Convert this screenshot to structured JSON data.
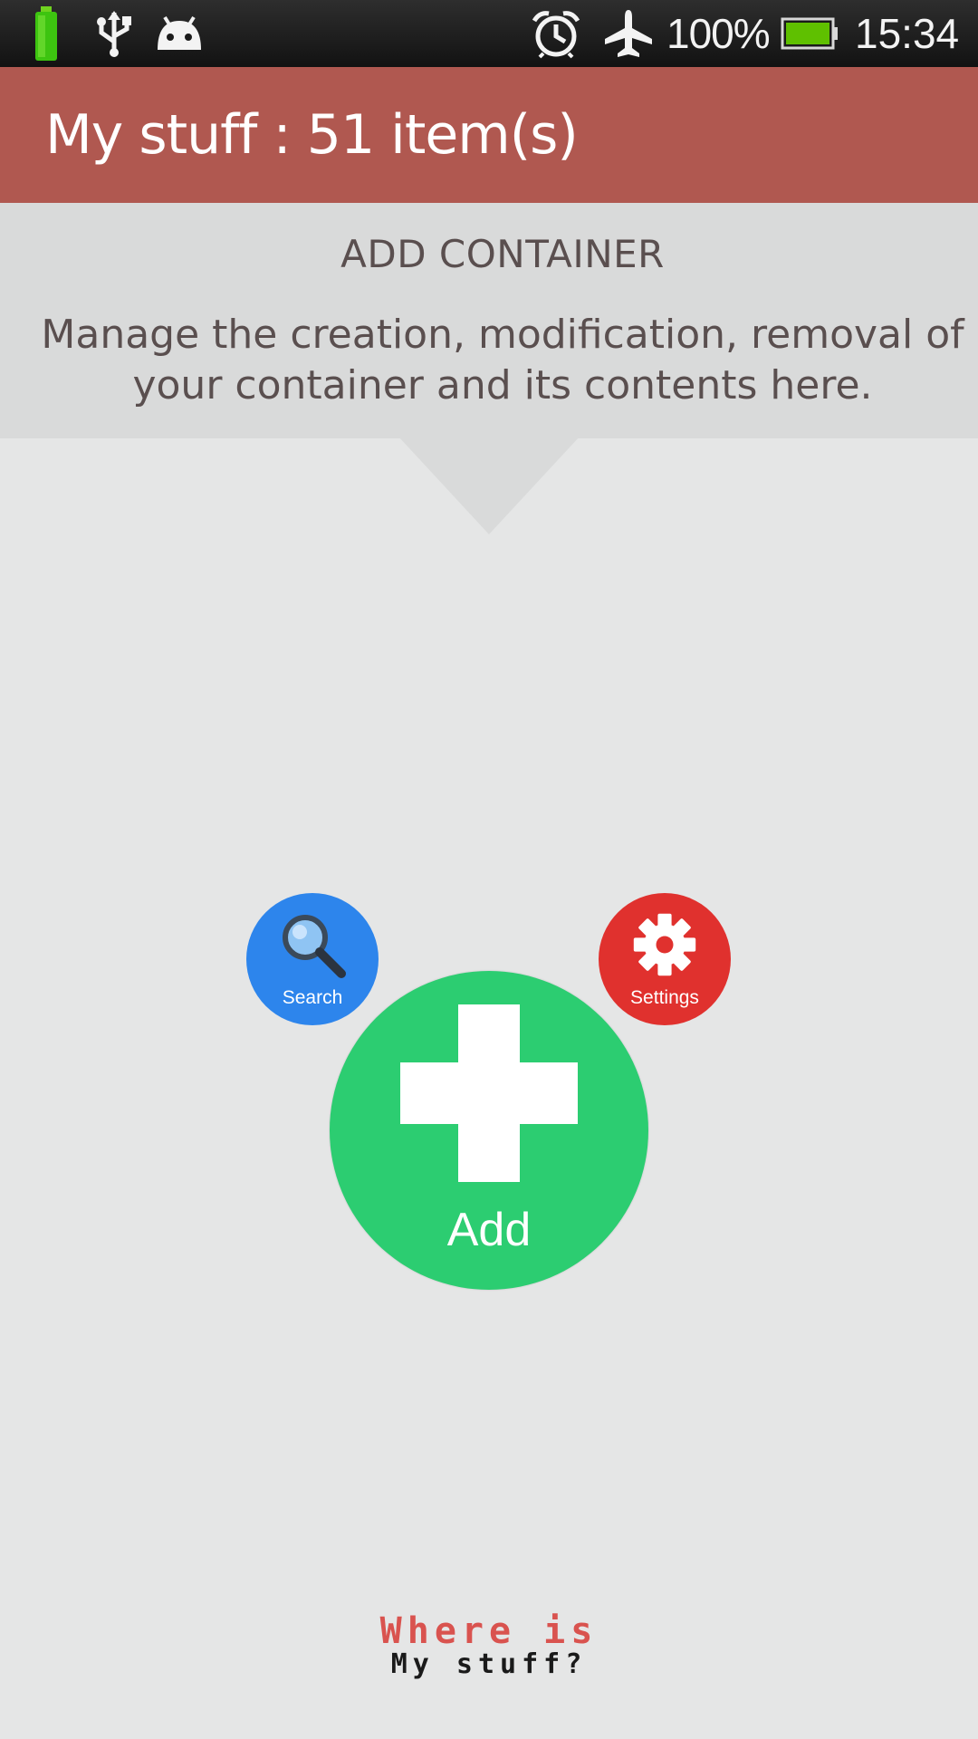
{
  "status_bar": {
    "icons": [
      "battery-charging-icon",
      "usb-icon",
      "android-debug-icon",
      "alarm-icon",
      "airplane-mode-icon",
      "battery-icon"
    ],
    "battery_percent": "100%",
    "time": "15:34",
    "battery_color": "#5fc000"
  },
  "header": {
    "title": "My stuff : 51 item(s)",
    "background": "#b05850"
  },
  "info": {
    "title": "ADD CONTAINER",
    "description": "Manage the creation, modification, removal of your container and its contents here."
  },
  "actions": {
    "search_label": "Search",
    "settings_label": "Settings",
    "add_label": "Add",
    "search_color": "#2d85ec",
    "settings_color": "#e0312e",
    "add_color": "#2ccd71"
  },
  "logo": {
    "line1": "Where is",
    "line2": "My stuff?"
  }
}
